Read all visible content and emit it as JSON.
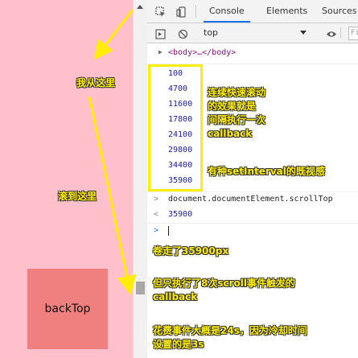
{
  "page": {
    "back_top_label": "backTop"
  },
  "devtools": {
    "tabs": [
      "Console",
      "Elements",
      "Sources"
    ],
    "active_tab": "Console",
    "context": "top",
    "filter_placeholder": "Fi"
  },
  "console": {
    "body_element": "<body>…</body>",
    "logged_values": [
      "100",
      "4700",
      "11600",
      "17800",
      "24100",
      "29800",
      "34400",
      "35900"
    ],
    "command": "document.documentElement.scrollTop",
    "result": "35900"
  },
  "annotations": {
    "from_here": "我从这里",
    "scroll_to_here": "滚到这里",
    "fast_scroll": [
      "连续快速滚动",
      "的效果就是",
      "间隔执行一次",
      "callback"
    ],
    "setinterval": "有种setInterval的既视感",
    "scrolled_px": "卷走了35900px",
    "triggered": [
      "但只执行了8次scroll事件触发的",
      "callback"
    ],
    "time_taken": [
      "花费事件大概是24s，因为冷却时间",
      "设置的是3s"
    ]
  },
  "colors": {
    "page_bg": "#ffc0cb",
    "back_top_bg": "#f08080",
    "annotation": "#ffee00",
    "number_blue": "#1a1aa6",
    "tab_active_underline": "#1a73e8"
  }
}
